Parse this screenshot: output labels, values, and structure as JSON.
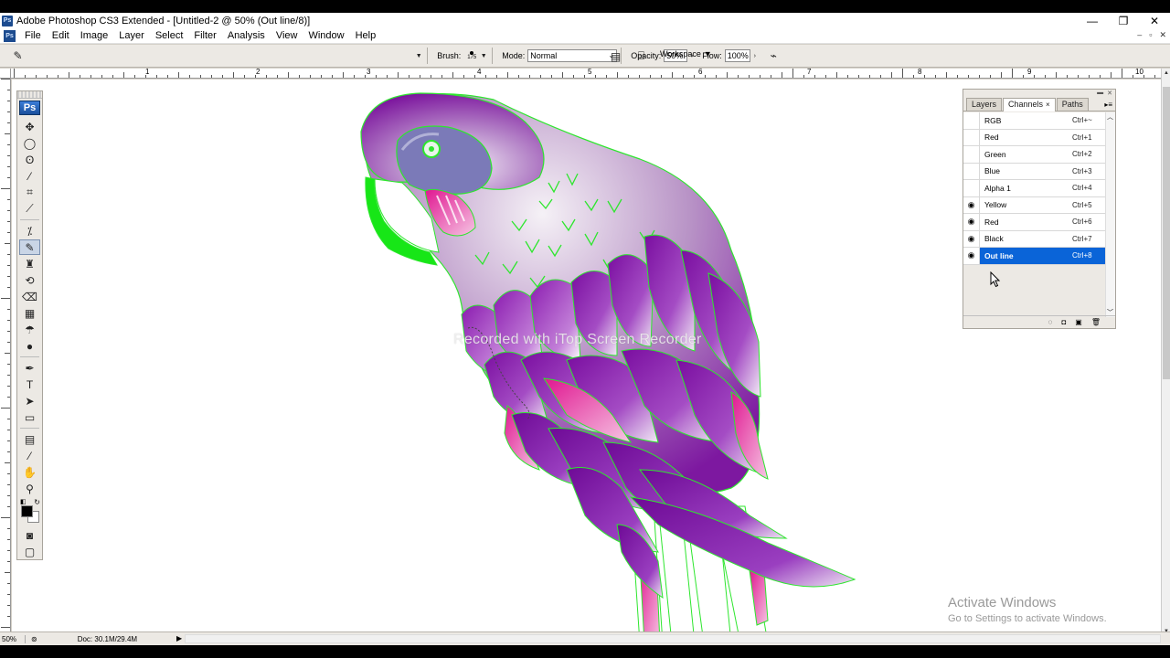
{
  "window": {
    "app_badge": "Ps",
    "title": "Adobe Photoshop CS3 Extended - [Untitled-2 @ 50% (Out line/8)]",
    "buttons": [
      "—",
      "❐",
      "✕"
    ]
  },
  "menu": {
    "items": [
      "File",
      "Edit",
      "Image",
      "Layer",
      "Select",
      "Filter",
      "Analysis",
      "View",
      "Window",
      "Help"
    ],
    "doc_buttons": [
      "–",
      "▫",
      "✕"
    ]
  },
  "options": {
    "brush_label": "Brush:",
    "brush_size": "175",
    "mode_label": "Mode:",
    "mode_value": "Normal",
    "opacity_label": "Opacity:",
    "opacity_value": "50%",
    "flow_label": "Flow:",
    "flow_value": "100%",
    "workspace_label": "Workspace"
  },
  "ruler": {
    "top_numbers": [
      "1",
      "2",
      "3",
      "4",
      "5",
      "6",
      "7",
      "8",
      "9",
      "10"
    ]
  },
  "tools": {
    "logo": "Ps"
  },
  "canvas": {
    "watermark": "Recorded with iTop Screen Recorder"
  },
  "activation": {
    "line1": "Activate Windows",
    "line2": "Go to Settings to activate Windows."
  },
  "status": {
    "zoom": "50%",
    "doc": "Doc: 30.1M/29.4M"
  },
  "panel": {
    "tabs": [
      "Layers",
      "Channels",
      "Paths"
    ],
    "active_tab": "Channels",
    "channels": [
      {
        "name": "RGB",
        "shortcut": "Ctrl+~",
        "visible": false,
        "selected": false
      },
      {
        "name": "Red",
        "shortcut": "Ctrl+1",
        "visible": false,
        "selected": false
      },
      {
        "name": "Green",
        "shortcut": "Ctrl+2",
        "visible": false,
        "selected": false
      },
      {
        "name": "Blue",
        "shortcut": "Ctrl+3",
        "visible": false,
        "selected": false
      },
      {
        "name": "Alpha 1",
        "shortcut": "Ctrl+4",
        "visible": false,
        "selected": false
      },
      {
        "name": "Yellow",
        "shortcut": "Ctrl+5",
        "visible": true,
        "selected": false
      },
      {
        "name": "Red",
        "shortcut": "Ctrl+6",
        "visible": true,
        "selected": false
      },
      {
        "name": "Black",
        "shortcut": "Ctrl+7",
        "visible": true,
        "selected": false
      },
      {
        "name": "Out line",
        "shortcut": "Ctrl+8",
        "visible": true,
        "selected": true
      }
    ]
  },
  "colors": {
    "selection_blue": "#0a64d8",
    "parrot_purple": "#8a1ea8",
    "outline_green": "#2ee62e",
    "accent_magenta": "#e0208c"
  }
}
